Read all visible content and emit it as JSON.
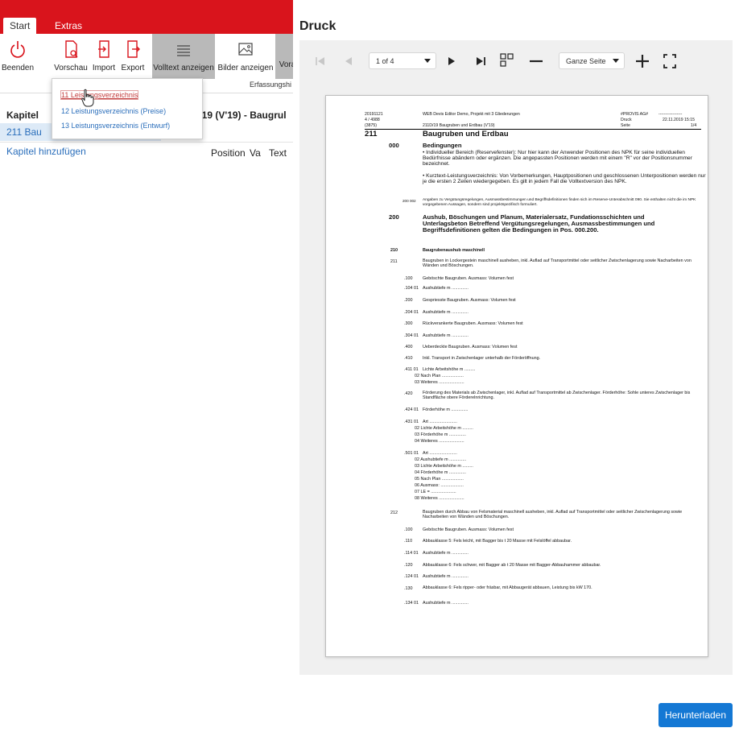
{
  "ribbon": {
    "tabs": [
      "Start",
      "Extras"
    ],
    "buttons": {
      "beenden": "Beenden",
      "vorschau": "Vorschau",
      "import": "Import",
      "export": "Export",
      "volltext": "Volltext anzeigen",
      "bilder": "Bilder anzeigen",
      "vora": "Vora"
    },
    "group_label": "Erfassungshi"
  },
  "vorschau_menu": {
    "items": [
      "11 Leistungsverzeichnis",
      "12 Leistungsverzeichnis (Preise)",
      "13 Leistungsverzeichnis (Entwurf)"
    ]
  },
  "left": {
    "kapitel_header": "Kapitel",
    "doc_title": "1D/19 (V'19) - Baugrul",
    "kapitel_row": "211 Bau",
    "add_kapitel": "Kapitel hinzufügen",
    "columns": [
      "Position",
      "Va",
      "Text"
    ]
  },
  "druck": {
    "title": "Druck",
    "page_indicator": "1 of 4",
    "zoom": "Ganze Seite",
    "download": "Herunterladen"
  },
  "colors": {
    "brand_red": "#d9141c",
    "link_blue": "#2a6ebb",
    "primary_button": "#1478d4"
  },
  "doc": {
    "hdr": {
      "l1": "20191121",
      "l2": "4 / 4988",
      "l3": "(3875)",
      "c1": "WEB Devis Editor Demo, Projekt mit 3 Gliederungen",
      "c3": "211D/19 Baugruben und Erdbau (V'19)",
      "r1a": "#PROVIS AG#",
      "r1b": "-----------------",
      "r2a": "Druck",
      "r2b": "22.11.2019 15:15",
      "r3a": "Seite",
      "r3b": "1/4"
    },
    "chapter_no": "211",
    "chapter_title": "Baugruben und Erdbau",
    "b000_no": "000",
    "b000_title": "Bedingungen",
    "b000_text1": "• Individueller Bereich (Reservefenster): Nur hier kann der Anwender Positionen des NPK für seine individuellen Bedürfnisse abändern oder ergänzen. Die angepassten Positionen werden mit einem \"R\" vor der Positionsnummer bezeichnet.",
    "b000_text2": "• Kurztext-Leistungsverzeichnis: Von Vorbemerkungen, Hauptpositionen und geschlossenen Unterpositionen werden nur je die ersten 2 Zeilen wiedergegeben. Es gilt in jedem Fall die Volltextversion des NPK.",
    "p200_002_no": "200 002",
    "p200_002_text": "Angaben zu Vergütungsregelungen, Ausmassbestimmungen und Begriffsdefinitionen finden sich im Reserve-Unterabschnitt 090. Sie enthalten nicht die im NPK vorgegebenen Aussagen, sondern sind projektspezifisch formuliert.",
    "b200_no": "200",
    "b200_title": "Aushub, Böschungen und Planum, Materialersatz, Fundationsschichten und Unterlagsbeton Betreffend Vergütungsregelungen, Ausmassbestimmungen und Begriffsdefinitionen gelten die Bedingungen in Pos. 000.200.",
    "p210_no": "210",
    "p210_text": "Baugrubenaushub maschinell",
    "p211_no": "211",
    "p211_text": "Baugruben in Lockergestein maschinell ausheben, inkl. Auflad auf Transportmittel oder seitlicher Zwischenlagerung sowie Nacharbeiten von Wänden und Böschungen.",
    "p100_no": ".100",
    "p100_text": "Geböschte Baugruben. Ausmass: Volumen fest",
    "p104_no": ".104 01",
    "p104_text": "Aushubtiefe m ..............",
    "p200s_no": ".200",
    "p200s_text": "Gespriesste Baugruben. Ausmass: Volumen fest",
    "p204_no": ".204 01",
    "p204_text": "Aushubtiefe m ..............",
    "p300_no": ".300",
    "p300_text": "Rückverankerte Baugruben. Ausmass: Volumen fest",
    "p304_no": ".304 01",
    "p304_text": "Aushubtiefe m ..............",
    "p400_no": ".400",
    "p400_text": "Ueberdeckte Baugruben. Ausmass: Volumen fest",
    "p410_no": ".410",
    "p410_text": "Inkl. Transport in Zwischenlager unterhalb der Förderöffnung.",
    "p411_no": ".411 01",
    "p411_l1": "Lichte Arbeitshöhe m .........",
    "p411_l2": "02 Nach Plan ..................",
    "p411_l3": "03 Weiteres .....................",
    "p420_no": ".420",
    "p420_text": "Förderung des Materials ab Zwischenlager, inkl. Auflad auf Transportmittel ab Zwischenlager. Förderhöhe: Sohle unteres Zwischenlager bis Standfläche obere Förderelnrichtung.",
    "p424_no": ".424 01",
    "p424_text": "Förderhöhe m ..............",
    "p431_no": ".431 01",
    "p431_l1": "Art .......................",
    "p431_l2": "02 Lichte Arbeitshöhe m .........",
    "p431_l3": "03 Förderhöhe m ..............",
    "p431_l4": "04 Weiteres .....................",
    "p501_no": ".501 01",
    "p501_l1": "Art .......................",
    "p501_l2": "02 Aushubtiefe m ..............",
    "p501_l3": "03 Lichte Arbeitshöhe m .........",
    "p501_l4": "04 Förderhöhe m ..............",
    "p501_l5": "05 Nach Plan ..................",
    "p501_l6": "06 Ausmass: ...................",
    "p501_l7": "07 LE = .....................",
    "p501_l8": "08 Weiteres .....................",
    "p212_no": "212",
    "p212_text": "Baugruben durch Abbau von Felsmaterial maschinell ausheben, inkl. Auflad auf Transportmittel oder seitlicher Zwischenlagerung sowie Nacharbeiten von Wänden und Böschungen.",
    "q100_no": ".100",
    "q100_text": "Geböschte Baugruben. Ausmass: Volumen fest",
    "q110_no": ".110",
    "q110_text": "Abbauklasse 5: Fels leicht, mit Bagger bis t 20 Masse mit Felslöffel abbaubar.",
    "q114_no": ".114 01",
    "q114_text": "Aushubtiefe m ..............",
    "q120_no": ".120",
    "q120_text": "Abbauklasse 6: Fels schwer, mit Bagger ab t 20 Masse mit Bagger-Abbauhammer abbaubar.",
    "q124_no": ".124 01",
    "q124_text": "Aushubtiefe m ..............",
    "q130_no": ".130",
    "q130_text": "Abbauklasse 6: Fels ripper- oder fräsbar, mit Abbaugerät abbauen, Leistung bis kW 170.",
    "q134_no": ".134 01",
    "q134_text": "Aushubtiefe m .............."
  }
}
